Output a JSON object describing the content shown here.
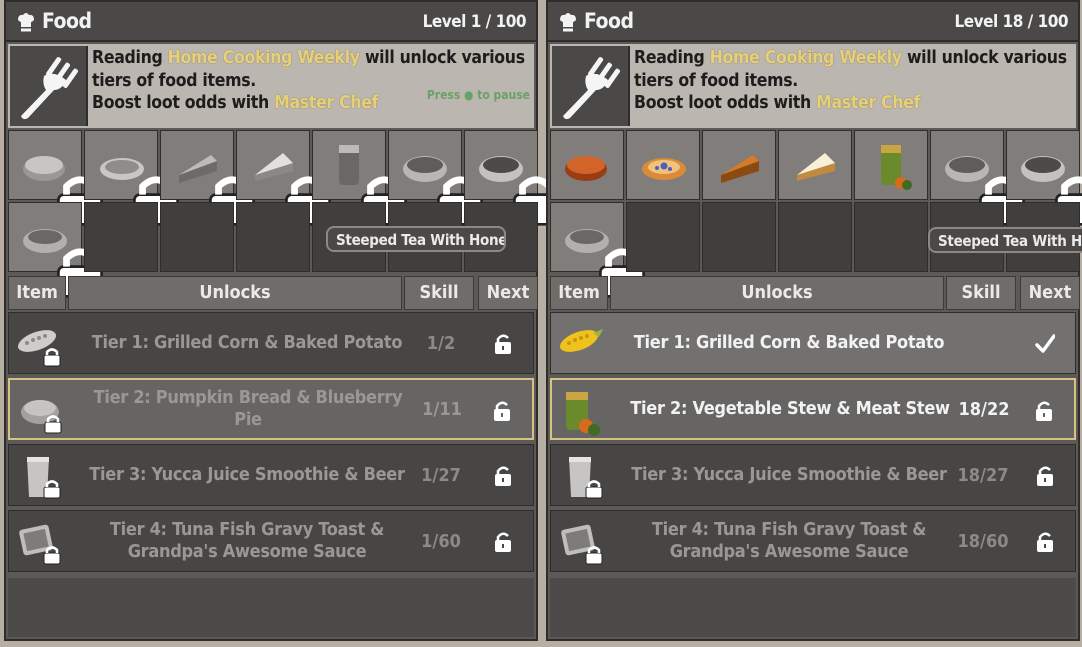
{
  "panels": [
    {
      "title": "Food",
      "level": "Level 1 / 100",
      "info_prefix": "Reading ",
      "book": "Home Cooking Weekly",
      "info_suffix": " will unlock various tiers of food items.",
      "boost_prefix": "Boost loot odds with ",
      "perk": "Master Chef",
      "press_hint": "Press ● to pause",
      "tooltip": "Steeped Tea With Honey",
      "headers": {
        "item": "Item",
        "unlocks": "Unlocks",
        "skill": "Skill",
        "next": "Next"
      },
      "rows": [
        {
          "label": "Tier 1: Grilled Corn & Baked Potato",
          "skill": "1/2"
        },
        {
          "label": "Tier 2: Pumpkin Bread & Blueberry Pie",
          "skill": "1/11"
        },
        {
          "label": "Tier 3: Yucca Juice Smoothie & Beer",
          "skill": "1/27"
        },
        {
          "label": "Tier 4: Tuna Fish Gravy Toast & Grandpa's Awesome Sauce",
          "skill": "1/60"
        }
      ]
    },
    {
      "title": "Food",
      "level": "Level 18 / 100",
      "info_prefix": "Reading ",
      "book": "Home Cooking Weekly",
      "info_suffix": " will unlock various tiers of food items.",
      "boost_prefix": "Boost loot odds with ",
      "perk": "Master Chef",
      "tooltip": "Steeped Tea With Honey",
      "headers": {
        "item": "Item",
        "unlocks": "Unlocks",
        "skill": "Skill",
        "next": "Next"
      },
      "rows": [
        {
          "label": "Tier 1: Grilled Corn & Baked Potato",
          "skill": ""
        },
        {
          "label": "Tier 2: Vegetable Stew & Meat Stew",
          "skill": "18/22"
        },
        {
          "label": "Tier 3: Yucca Juice Smoothie & Beer",
          "skill": "18/27"
        },
        {
          "label": "Tier 4: Tuna Fish Gravy Toast & Grandpa's Awesome Sauce",
          "skill": "18/60"
        }
      ]
    }
  ]
}
